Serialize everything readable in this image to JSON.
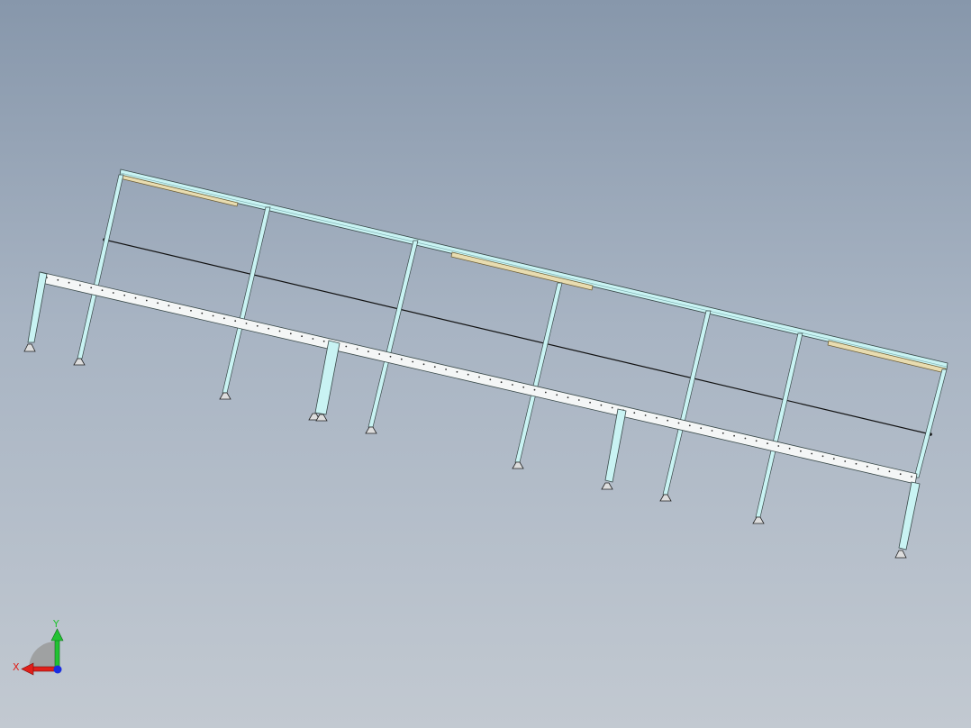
{
  "viewport": {
    "background_top": "#8797ab",
    "background_bottom": "#c2c9d1"
  },
  "model": {
    "frame_color": "#c9f3f3",
    "outline_color": "#3a4a4a",
    "panel_color": "#e8dcb0",
    "bracing_color": "#111111"
  },
  "triad": {
    "x_label": "X",
    "y_label": "Y",
    "x_color": "#e0201a",
    "y_color": "#22c232",
    "z_color": "#1a2ee0"
  }
}
